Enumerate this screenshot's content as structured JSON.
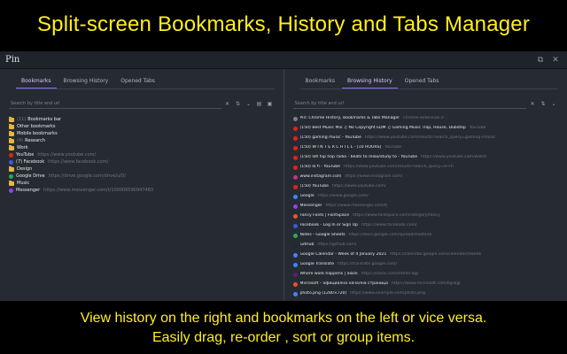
{
  "banner": {
    "title": "Split-screen Bookmarks, History and Tabs Manager",
    "line1": "View history on the right and bookmarks on the left or vice versa.",
    "line2": "Easily drag, re-order , sort or group items."
  },
  "window": {
    "title": "Pin"
  },
  "left": {
    "tabs": [
      "Bookmarks",
      "Browsing History",
      "Opened Tabs"
    ],
    "active_tab": 0,
    "search_placeholder": "Search by title and url",
    "items": [
      {
        "kind": "folder",
        "count": "(11)",
        "label": "Bookmarks bar",
        "url": ""
      },
      {
        "kind": "folder",
        "count": "",
        "label": "Other bookmarks",
        "url": ""
      },
      {
        "kind": "folder",
        "count": "",
        "label": "Mobile bookmarks",
        "url": ""
      },
      {
        "kind": "folder",
        "count": "(4)",
        "label": "Research",
        "url": ""
      },
      {
        "kind": "folder",
        "count": "",
        "label": "Work",
        "url": ""
      },
      {
        "kind": "link",
        "color": "#e62117",
        "label": "YouTube",
        "url": "https://www.youtube.com/"
      },
      {
        "kind": "link",
        "color": "#3b5bdb",
        "label": "(7) Facebook",
        "url": "https://www.facebook.com/"
      },
      {
        "kind": "folder",
        "count": "",
        "label": "Design",
        "url": ""
      },
      {
        "kind": "link",
        "color": "#2fa84f",
        "label": "Google Drive",
        "url": "https://drive.google.com/drive/u/0/"
      },
      {
        "kind": "folder",
        "count": "",
        "label": "Music",
        "url": ""
      },
      {
        "kind": "link",
        "color": "#8e44ef",
        "label": "Messenger",
        "url": "https://www.messenger.com/t/100006590947483"
      }
    ]
  },
  "right": {
    "tabs": [
      "Bookmarks",
      "Browsing History",
      "Opened Tabs"
    ],
    "active_tab": 1,
    "search_placeholder": "Search by title and url",
    "items": [
      {
        "color": "#7a7f88",
        "label": "Pin: Chrome History, Bookmarks & Tabs Manager",
        "url": "chrome-extension://..."
      },
      {
        "color": "#e62117",
        "label": "(150) Best Music Mix ♫ No Copyright EDM ♫ Gaming Music Trap, House, Dubstep",
        "url": "YouTube"
      },
      {
        "color": "#e62117",
        "label": "(150) gaming music - YouTube",
        "url": "https://www.youtube.com/results?search_query=gaming+music"
      },
      {
        "color": "#e62117",
        "label": "(150) W I N T E R   C H I L L - [10 HOURS]",
        "url": "YouTube"
      },
      {
        "color": "#e62117",
        "label": "(150) lofi hip hop radio - beats to relax/study to - YouTube",
        "url": "https://www.youtube.com/watch"
      },
      {
        "color": "#e62117",
        "label": "(150) lo fi - YouTube",
        "url": "https://www.youtube.com/results?search_query=lo+fi"
      },
      {
        "color": "#c13584",
        "label": "www.instagram.com",
        "url": "https://www.instagram.com/"
      },
      {
        "color": "#e62117",
        "label": "(150) YouTube",
        "url": "https://www.youtube.com/"
      },
      {
        "color": "#4285f4",
        "label": "Google",
        "url": "https://www.google.com/"
      },
      {
        "color": "#8e44ef",
        "label": "Messenger",
        "url": "https://www.messenger.com/t/"
      },
      {
        "color": "#e05a2b",
        "label": "Fancy Fonts | FontSpace",
        "url": "https://www.fontspace.com/category/fancy"
      },
      {
        "color": "#3b5bdb",
        "label": "Facebook - Log In or Sign Up",
        "url": "https://www.facebook.com/"
      },
      {
        "color": "#2fa84f",
        "label": "Notes - Google Sheets",
        "url": "https://docs.google.com/spreadsheets/d/"
      },
      {
        "color": "#24292e",
        "label": "GitHub",
        "url": "https://github.com/"
      },
      {
        "color": "#4285f4",
        "label": "Google Calendar - Week of 4 January 2021",
        "url": "https://calendar.google.com/calendar/r/week"
      },
      {
        "color": "#4285f4",
        "label": "Google Translate",
        "url": "https://translate.google.com/"
      },
      {
        "color": "#611f69",
        "label": "Where work happens | Slack",
        "url": "https://slack.com/intl/en-bg/"
      },
      {
        "color": "#f25022",
        "label": "Microsoft – официална начална страница",
        "url": "https://www.microsoft.com/bg-bg/"
      },
      {
        "color": "#4285f4",
        "label": "photo.png (1280×720)",
        "url": "https://www.example.com/photo.png"
      }
    ]
  }
}
